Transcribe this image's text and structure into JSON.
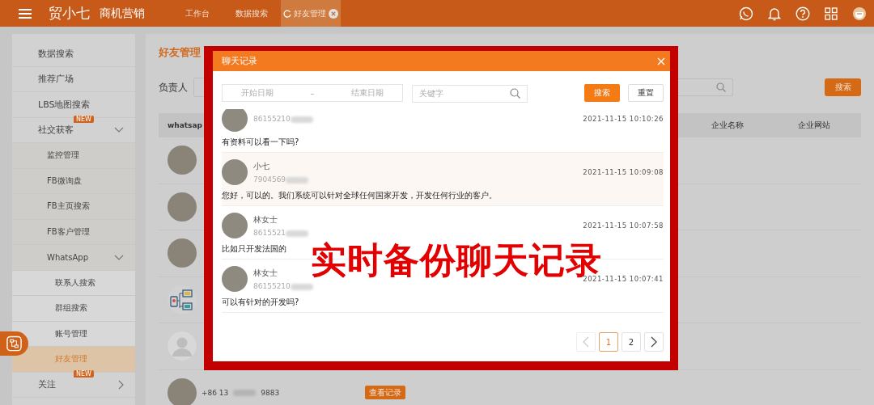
{
  "header": {
    "logo": "贸小七",
    "product": "商机营销",
    "tabs": [
      {
        "label": "工作台",
        "selected": false
      },
      {
        "label": "数据搜索",
        "selected": false
      },
      {
        "label": "好友管理",
        "selected": true
      }
    ]
  },
  "sidebar": {
    "items": [
      {
        "label": "数据搜索",
        "selected": false
      },
      {
        "label": "推荐广场",
        "selected": false
      },
      {
        "label": "LBS地图搜索",
        "selected": false
      },
      {
        "label": "社交获客",
        "badge": "NEW",
        "expanded": true,
        "selected": false,
        "children": [
          {
            "label": "监控管理",
            "selected": false
          },
          {
            "label": "FB微询盘",
            "selected": false
          },
          {
            "label": "FB主页搜索",
            "selected": false
          },
          {
            "label": "FB客户管理",
            "selected": false
          },
          {
            "label": "WhatsApp",
            "expanded": true,
            "selected": false,
            "children": [
              {
                "label": "联系人搜索",
                "selected": false
              },
              {
                "label": "群组搜索",
                "selected": false
              },
              {
                "label": "账号管理",
                "selected": false
              },
              {
                "label": "好友管理",
                "selected": true
              }
            ]
          }
        ]
      },
      {
        "label": "关注",
        "badge": "NEW",
        "expanded": false,
        "selected": false
      }
    ]
  },
  "main": {
    "title": "好友管理",
    "filter_label": "负责人",
    "search_button": "搜索",
    "table": {
      "columns": [
        "whatsap",
        "企业名称",
        "企业网站"
      ],
      "rows": [
        {
          "kind": "photo"
        },
        {
          "kind": "photo"
        },
        {
          "kind": "photo"
        },
        {
          "kind": "illustration"
        },
        {
          "kind": "default"
        },
        {
          "kind": "photo",
          "phone": "+86 13",
          "phone_tail": "9883",
          "action": "查看记录"
        }
      ]
    }
  },
  "modal": {
    "title": "聊天记录",
    "date_range": {
      "start_placeholder": "开始日期",
      "separator": "–",
      "end_placeholder": "结束日期"
    },
    "keyword_placeholder": "关键字",
    "buttons": [
      {
        "label": "搜索",
        "kind": "primary"
      },
      {
        "label": "重置",
        "kind": "default"
      }
    ],
    "messages": [
      {
        "phone": "86155210",
        "time": "2021-11-15 10:10:26",
        "text": "有资料可以看一下吗?",
        "highlighted": false
      },
      {
        "name": "小七",
        "phone": "7904569",
        "time": "2021-11-15 10:09:08",
        "text": "您好，可以的。我们系统可以针对全球任何国家开发，开发任何行业的客户。",
        "highlighted": true
      },
      {
        "name": "林女士",
        "phone": "8615521",
        "time": "2021-11-15 10:07:58",
        "text": "比如只开发法国的",
        "highlighted": false
      },
      {
        "name": "林女士",
        "phone": "86155210",
        "time": "2021-11-15 10:07:41",
        "text": "可以有针对的开发吗?",
        "highlighted": false
      }
    ],
    "pagination": {
      "prev_disabled": true,
      "next_disabled": false,
      "pages": [
        {
          "label": "1",
          "selected": true
        },
        {
          "label": "2",
          "selected": false
        }
      ]
    }
  },
  "caption": "实时备份聊天记录"
}
